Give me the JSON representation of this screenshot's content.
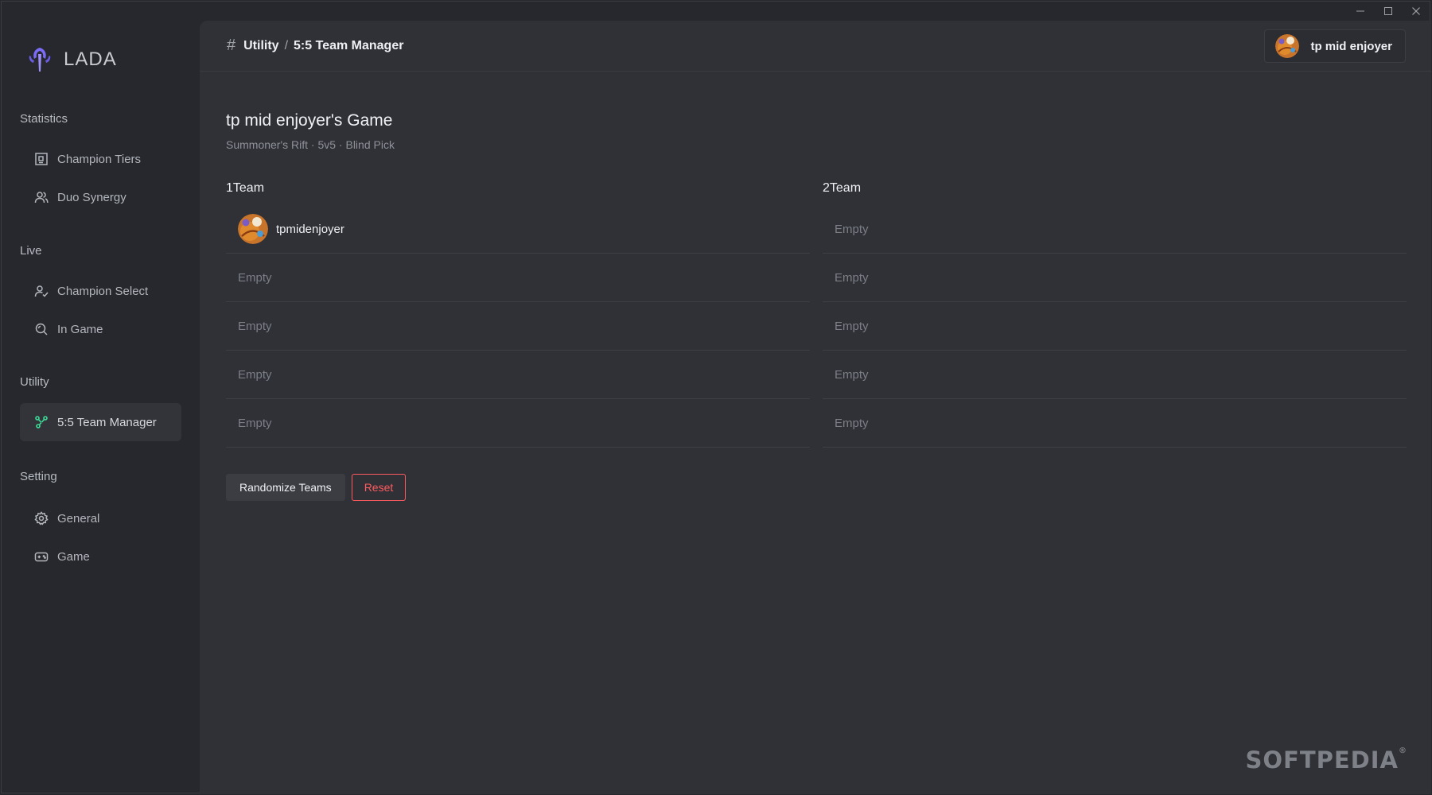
{
  "app": {
    "name": "LADA"
  },
  "window_controls": {
    "minimize": "─",
    "maximize": "☐",
    "close": "✕"
  },
  "sidebar": {
    "sections": [
      {
        "title": "Statistics",
        "items": [
          {
            "label": "Champion Tiers",
            "icon": "tier-list-icon"
          },
          {
            "label": "Duo Synergy",
            "icon": "users-icon"
          }
        ]
      },
      {
        "title": "Live",
        "items": [
          {
            "label": "Champion Select",
            "icon": "user-check-icon"
          },
          {
            "label": "In Game",
            "icon": "search-icon"
          }
        ]
      },
      {
        "title": "Utility",
        "items": [
          {
            "label": "5:5 Team Manager",
            "icon": "share-nodes-icon",
            "active": true
          }
        ]
      },
      {
        "title": "Setting",
        "items": [
          {
            "label": "General",
            "icon": "gear-icon"
          },
          {
            "label": "Game",
            "icon": "gamepad-icon"
          }
        ]
      }
    ]
  },
  "header": {
    "breadcrumb": [
      "Utility",
      "5:5 Team Manager"
    ],
    "separator": "/",
    "user": "tp mid enjoyer"
  },
  "game": {
    "title": "tp mid enjoyer's Game",
    "subtitle": "Summoner's Rift · 5v5 · Blind Pick"
  },
  "teams": [
    {
      "title": "1Team",
      "slots": [
        "tpmidenjoyer",
        "Empty",
        "Empty",
        "Empty",
        "Empty"
      ]
    },
    {
      "title": "2Team",
      "slots": [
        "Empty",
        "Empty",
        "Empty",
        "Empty",
        "Empty"
      ]
    }
  ],
  "actions": {
    "randomize": "Randomize Teams",
    "reset": "Reset"
  },
  "watermark": {
    "text": "SOFTPEDIA",
    "mark": "®"
  },
  "colors": {
    "accent": "#3ddc97",
    "danger": "#ff5a5f",
    "logo": "#7b6cf6"
  }
}
